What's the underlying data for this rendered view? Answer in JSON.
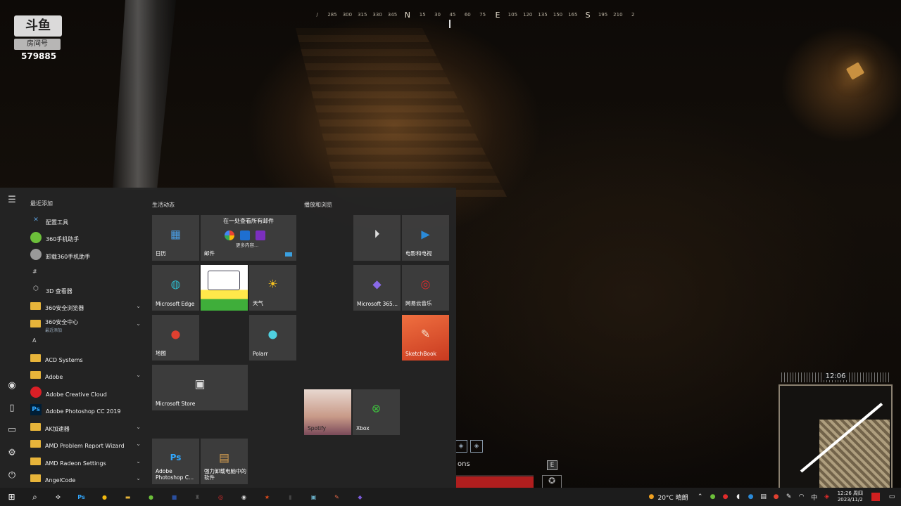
{
  "compass": {
    "ticks": [
      "/",
      "285",
      "300",
      "315",
      "330",
      "345",
      "N",
      "15",
      "30",
      "45",
      "60",
      "75",
      "E",
      "105",
      "120",
      "135",
      "150",
      "165",
      "S",
      "195",
      "210",
      "2"
    ]
  },
  "watermark": {
    "brand": "斗鱼",
    "subtitle": "房间号",
    "room_number": "579885"
  },
  "game_hud": {
    "minimap_time": "12:06",
    "key_hint": "E",
    "partial_text": "ons"
  },
  "start_menu": {
    "recent_header": "最近添加",
    "apps": [
      {
        "type": "app",
        "label": "配置工具",
        "icon": "tools-icon",
        "color": "#5b9bd5"
      },
      {
        "type": "app",
        "label": "360手机助手",
        "icon": "360-icon",
        "color": "#6cbf3a"
      },
      {
        "type": "app",
        "label": "卸载360手机助手",
        "icon": "uninstall-icon",
        "color": "#999999"
      },
      {
        "type": "letter",
        "label": "#"
      },
      {
        "type": "app",
        "label": "3D 查看器",
        "icon": "cube-icon",
        "color": "#cccccc"
      },
      {
        "type": "folder",
        "label": "360安全浏览器",
        "chevron": true
      },
      {
        "type": "folder",
        "label": "360安全中心",
        "sublabel": "最近添加",
        "chevron": true
      },
      {
        "type": "letter",
        "label": "A"
      },
      {
        "type": "folder",
        "label": "ACD Systems",
        "chevron": false
      },
      {
        "type": "folder",
        "label": "Adobe",
        "chevron": true
      },
      {
        "type": "app",
        "label": "Adobe Creative Cloud",
        "icon": "creative-cloud-icon",
        "color": "#da1f26"
      },
      {
        "type": "app",
        "label": "Adobe Photoshop CC 2019",
        "icon": "photoshop-icon",
        "color": "#31a8ff"
      },
      {
        "type": "folder",
        "label": "AK加速器",
        "chevron": true
      },
      {
        "type": "folder",
        "label": "AMD Problem Report Wizard",
        "chevron": true
      },
      {
        "type": "folder",
        "label": "AMD Radeon Settings",
        "chevron": true
      },
      {
        "type": "folder",
        "label": "AngelCode",
        "chevron": true
      }
    ],
    "groups": {
      "life": "生活动态",
      "play": "播放和浏览"
    },
    "tiles": {
      "calendar": "日历",
      "mail_title": "在一处查看所有邮件",
      "mail_more": "更多内容...",
      "mail": "邮件",
      "edge": "Microsoft Edge",
      "weather": "天气",
      "maps": "地图",
      "polarr": "Polarr",
      "store": "Microsoft Store",
      "photoshop": "Adobe Photoshop C...",
      "uninstall_software": "强力卸载电脑中的软件",
      "movies": "电影和电视",
      "office": "Microsoft 365...",
      "netease_music": "网易云音乐",
      "sketchbook": "SketchBook",
      "spotify": "Spotify",
      "xbox": "Xbox"
    }
  },
  "taskbar": {
    "apps": [
      {
        "icon": "widgets-icon",
        "color": "#ffffff",
        "glyph": "✣"
      },
      {
        "icon": "photoshop-icon",
        "color": "#31a8ff",
        "glyph": "Ps"
      },
      {
        "icon": "chrome-icon",
        "color": "#f2b90f",
        "glyph": "●"
      },
      {
        "icon": "folder-icon",
        "color": "#e7b43a",
        "glyph": "▬"
      },
      {
        "icon": "360-icon",
        "color": "#6cbf3a",
        "glyph": "●"
      },
      {
        "icon": "app-blue-icon",
        "color": "#2a4f9e",
        "glyph": "■"
      },
      {
        "icon": "game-icon",
        "color": "#555555",
        "glyph": "♜"
      },
      {
        "icon": "netease-music-icon",
        "color": "#e02b2b",
        "glyph": "◎"
      },
      {
        "icon": "steam-icon",
        "color": "#dddddd",
        "glyph": "◉"
      },
      {
        "icon": "game2-icon",
        "color": "#e04a1a",
        "glyph": "★"
      },
      {
        "icon": "app-dark-icon",
        "color": "#444444",
        "glyph": "▮"
      },
      {
        "icon": "image-viewer-icon",
        "color": "#6ab0c8",
        "glyph": "▣"
      },
      {
        "icon": "pen-icon",
        "color": "#e86a4a",
        "glyph": "✎"
      },
      {
        "icon": "office-icon",
        "color": "#7a5ad8",
        "glyph": "◆"
      }
    ],
    "weather": "20°C 晴朗",
    "ime": "中",
    "time": "12:26 周四",
    "date": "2023/11/2"
  }
}
